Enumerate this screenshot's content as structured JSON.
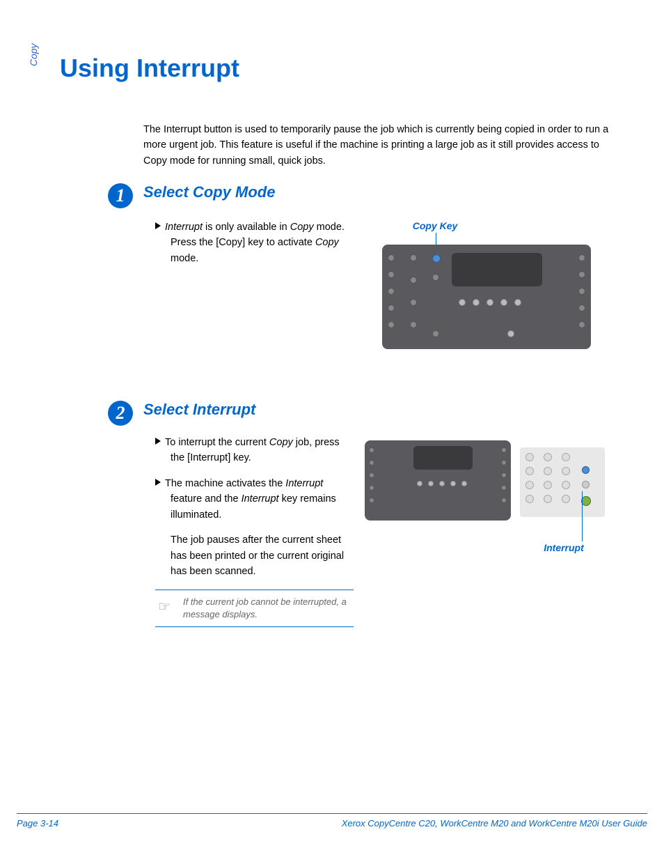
{
  "sidebar_label": "Copy",
  "page_title": "Using Interrupt",
  "intro": "The Interrupt button is used to temporarily pause the job which is currently being copied in order to run a more urgent job. This feature is useful if the machine is printing a large job as it still provides access to Copy mode for running small, quick jobs.",
  "steps": {
    "one": {
      "num": "1",
      "title": "Select Copy Mode",
      "bullets": [
        {
          "pre": "",
          "it1": "Interrupt",
          "mid1": " is only available in ",
          "it2": "Copy",
          "mid2": " mode. Press the [Copy] key to activate ",
          "it3": "Copy",
          "post": " mode."
        }
      ],
      "fig_label": "Copy Key"
    },
    "two": {
      "num": "2",
      "title": "Select Interrupt",
      "bullets": [
        {
          "pre": "To interrupt the current ",
          "it1": "Copy",
          "post": " job, press the [Interrupt] key."
        },
        {
          "pre": "The machine activates the ",
          "it1": "Interrupt",
          "mid1": " feature and the ",
          "it2": "Interrupt",
          "post": " key remains illuminated."
        }
      ],
      "plain": "The job pauses after the current sheet has been printed or the current original has been scanned.",
      "note": "If the current job cannot be interrupted, a message displays.",
      "fig_label": "Interrupt"
    }
  },
  "footer": {
    "page": "Page 3-14",
    "guide": "Xerox CopyCentre C20, WorkCentre M20 and WorkCentre M20i User Guide"
  }
}
